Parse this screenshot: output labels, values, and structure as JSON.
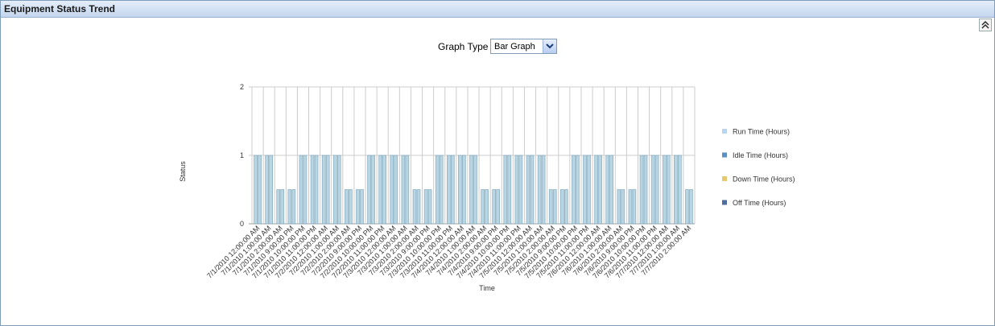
{
  "panel": {
    "title": "Equipment Status Trend"
  },
  "controls": {
    "graph_type_label": "Graph Type",
    "graph_type_value": "Bar Graph"
  },
  "colors": {
    "run": "#b9d6ee",
    "idle": "#5c8fc2",
    "down": "#e7c86e",
    "off": "#4f6c9e",
    "bar_fill": "#b8d5e3",
    "bar_stroke": "#7aa2b8",
    "grid": "#cccccc"
  },
  "chart_data": {
    "type": "bar",
    "title": "",
    "xlabel": "Time",
    "ylabel": "Status",
    "ylim": [
      0,
      2
    ],
    "yticks": [
      "0",
      "1",
      "2"
    ],
    "grid": true,
    "legend_position": "right",
    "legend": [
      "Run Time (Hours)",
      "Idle Time (Hours)",
      "Down Time (Hours)",
      "Off Time (Hours)"
    ],
    "categories": [
      "7/1/2010 12:00:00 AM",
      "7/1/2010 1:00:00 AM",
      "7/1/2010 2:00:00 AM",
      "7/1/2010 9:00:00 PM",
      "7/1/2010 10:00:00 PM",
      "7/1/2010 11:00:00 PM",
      "7/2/2010 12:00:00 AM",
      "7/2/2010 1:00:00 AM",
      "7/2/2010 2:00:00 AM",
      "7/2/2010 9:00:00 PM",
      "7/2/2010 10:00:00 PM",
      "7/2/2010 11:00:00 PM",
      "7/3/2010 12:00:00 AM",
      "7/3/2010 1:00:00 AM",
      "7/3/2010 2:00:00 AM",
      "7/3/2010 9:00:00 PM",
      "7/3/2010 10:00:00 PM",
      "7/3/2010 11:00:00 PM",
      "7/4/2010 12:00:00 AM",
      "7/4/2010 1:00:00 AM",
      "7/4/2010 2:00:00 AM",
      "7/4/2010 9:00:00 PM",
      "7/4/2010 10:00:00 PM",
      "7/4/2010 11:00:00 PM",
      "7/5/2010 12:00:00 AM",
      "7/5/2010 1:00:00 AM",
      "7/5/2010 2:00:00 AM",
      "7/5/2010 9:00:00 PM",
      "7/5/2010 10:00:00 PM",
      "7/5/2010 11:00:00 PM",
      "7/6/2010 12:00:00 AM",
      "7/6/2010 1:00:00 AM",
      "7/6/2010 2:00:00 AM",
      "7/6/2010 9:00:00 PM",
      "7/6/2010 10:00:00 PM",
      "7/6/2010 11:00:00 PM",
      "7/7/2010 12:00:00 AM",
      "7/7/2010 1:00:00 AM",
      "7/7/2010 2:00:00 AM"
    ],
    "values": [
      1,
      1,
      0.5,
      0.5,
      1,
      1,
      1,
      1,
      0.5,
      0.5,
      1,
      1,
      1,
      1,
      0.5,
      0.5,
      1,
      1,
      1,
      1,
      0.5,
      0.5,
      1,
      1,
      1,
      1,
      0.5,
      0.5,
      1,
      1,
      1,
      1,
      0.5,
      0.5,
      1,
      1,
      1,
      1,
      0.5
    ]
  }
}
